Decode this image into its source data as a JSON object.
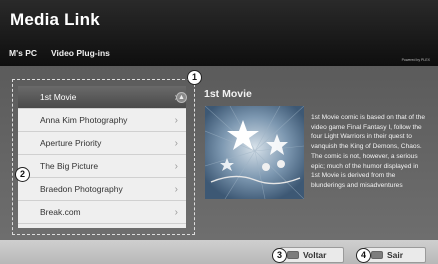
{
  "header": {
    "title": "Media Link",
    "tabs": [
      "M's PC",
      "Video Plug-ins"
    ],
    "powered_by": "Powered by PLEX"
  },
  "list": {
    "items": [
      "1st Movie",
      "Anna Kim Photography",
      "Aperture Priority",
      "The Big Picture",
      "Braedon Photography",
      "Break.com"
    ],
    "selected_index": 0,
    "chevron": "›"
  },
  "detail": {
    "title": "1st Movie",
    "description": "1st Movie comic is based on that of the video game Final Fantasy I, follow the four Light Warriors in their quest to vanquish the King of Demons, Chaos. The comic is not, however, a serious epic; much of the humor displayed in 1st Movie is derived from the blunderings and misadventures"
  },
  "callouts": [
    "1",
    "2",
    "3",
    "4"
  ],
  "buttons": {
    "back": "Voltar",
    "exit": "Sair"
  },
  "icons": {
    "scroll": "up-arrow-icon",
    "back": "remote-back-icon",
    "exit": "remote-exit-icon"
  },
  "colors": {
    "header": "#121212",
    "content": "#636363",
    "selected_item": "#5a5a5a",
    "list_bg": "#efefef"
  }
}
